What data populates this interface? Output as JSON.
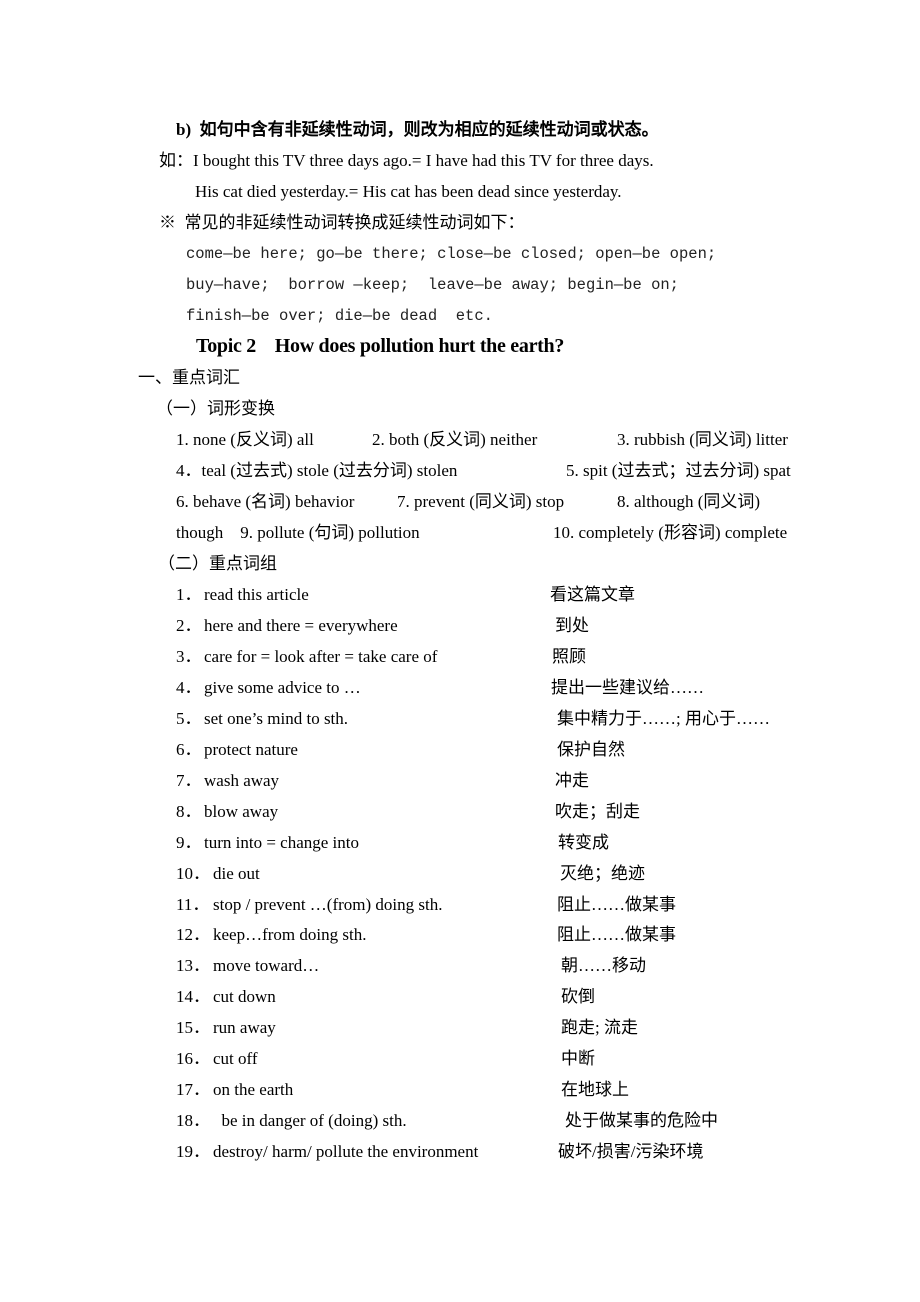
{
  "section_b": {
    "heading": "b)  如句中含有非延续性动词，则改为相应的延续性动词或状态。",
    "example_prefix": "如：",
    "example1": "I bought this TV three days ago.= I have had this TV for three days.",
    "example2": "His cat died yesterday.= His cat has been dead since yesterday.",
    "note_symbol": "※",
    "note": "常见的非延续性动词转换成延续性动词如下：",
    "conversions": [
      "come—be here; go—be there; close—be closed; open—be open;",
      "buy—have;  borrow —keep;  leave—be away; begin—be on;",
      "finish—be over; die—be dead  etc."
    ]
  },
  "topic": {
    "title": "Topic 2    How does pollution hurt the earth?"
  },
  "vocab": {
    "heading": "一、重点词汇",
    "word_forms": {
      "heading": "（一）词形变换",
      "lines": [
        [
          "1. none (反义词) all",
          "2. both (反义词) neither",
          "3. rubbish (同义词) litter"
        ],
        [
          "4．teal (过去式) stole (过去分词) stolen",
          "5. spit (过去式；过去分词) spat"
        ],
        [
          "6. behave (名词) behavior",
          "7. prevent (同义词) stop",
          "8. although (同义词)"
        ],
        [
          "though    9. pollute (句词) pollution",
          "10. completely (形容词) complete"
        ]
      ]
    },
    "phrases": {
      "heading": "（二）重点词组",
      "items": [
        {
          "num": "1．",
          "en": "read this article",
          "cn": "看这篇文章"
        },
        {
          "num": "2．",
          "en": "here and there = everywhere",
          "cn": "到处"
        },
        {
          "num": "3．",
          "en": "care for = look after = take care of",
          "cn": "照顾"
        },
        {
          "num": "4．",
          "en": "give some advice to …",
          "cn": "提出一些建议给……"
        },
        {
          "num": "5．",
          "en": "set one’s mind to sth.",
          "cn": "集中精力于……; 用心于……"
        },
        {
          "num": "6．",
          "en": "protect nature",
          "cn": "保护自然"
        },
        {
          "num": "7．",
          "en": "wash away",
          "cn": "冲走"
        },
        {
          "num": "8．",
          "en": "blow away",
          "cn": "吹走；刮走"
        },
        {
          "num": "9．",
          "en": "turn into = change into",
          "cn": "转变成"
        },
        {
          "num": "10．",
          "en": "die out",
          "cn": "灭绝；绝迹"
        },
        {
          "num": "11．",
          "en": "stop / prevent …(from) doing sth.",
          "cn": "阻止……做某事"
        },
        {
          "num": "12．",
          "en": "keep…from doing sth.",
          "cn": "阻止……做某事"
        },
        {
          "num": "13．",
          "en": "move toward…",
          "cn": "朝……移动"
        },
        {
          "num": "14．",
          "en": "cut down",
          "cn": "砍倒"
        },
        {
          "num": "15．",
          "en": "run away",
          "cn": "跑走; 流走"
        },
        {
          "num": "16．",
          "en": "cut off",
          "cn": "中断"
        },
        {
          "num": "17．",
          "en": "on the earth",
          "cn": "在地球上"
        },
        {
          "num": "18．",
          "en": "  be in danger of (doing) sth.",
          "cn": "处于做某事的危险中"
        },
        {
          "num": "19．",
          "en": "destroy/ harm/ pollute the environment",
          "cn": "破坏/损害/污染环境"
        }
      ]
    }
  }
}
